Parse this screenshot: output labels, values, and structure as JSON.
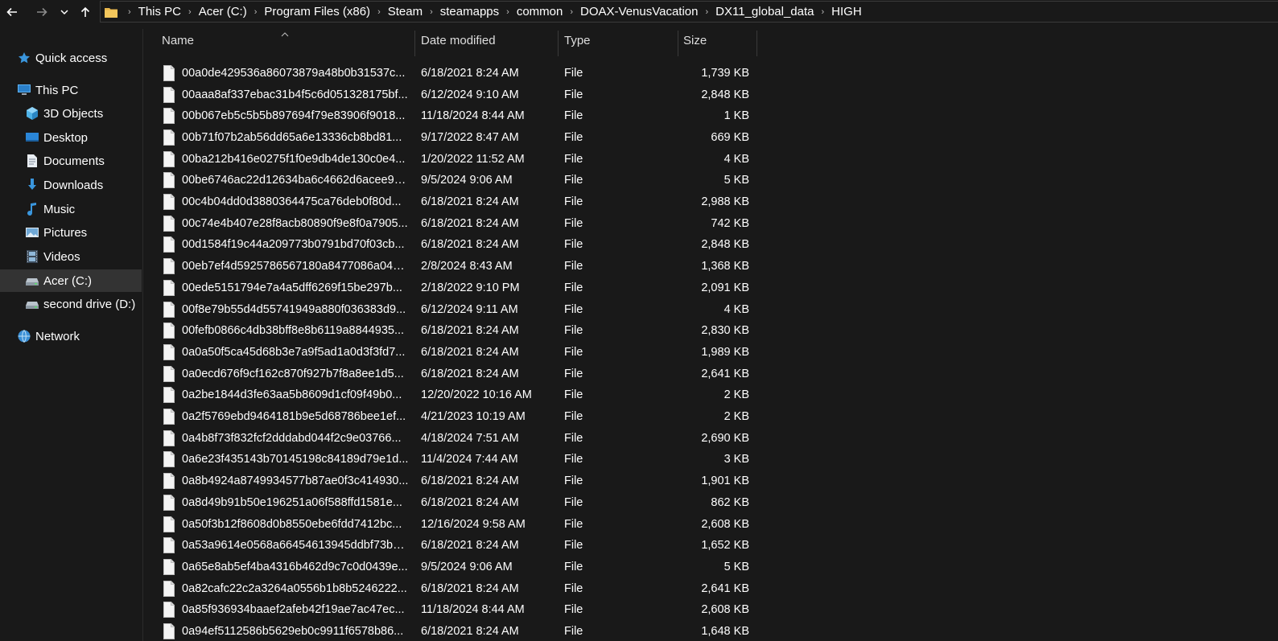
{
  "breadcrumb": [
    "This PC",
    "Acer (C:)",
    "Program Files (x86)",
    "Steam",
    "steamapps",
    "common",
    "DOAX-VenusVacation",
    "DX11_global_data",
    "HIGH"
  ],
  "sidebar": {
    "items": [
      {
        "label": "Quick access",
        "icon": "star-icon",
        "level": 0
      },
      {
        "label": "This PC",
        "icon": "computer-icon",
        "level": 0
      },
      {
        "label": "3D Objects",
        "icon": "cube-icon",
        "level": 1
      },
      {
        "label": "Desktop",
        "icon": "desktop-icon",
        "level": 1
      },
      {
        "label": "Documents",
        "icon": "document-icon",
        "level": 1
      },
      {
        "label": "Downloads",
        "icon": "download-icon",
        "level": 1
      },
      {
        "label": "Music",
        "icon": "music-note-icon",
        "level": 1
      },
      {
        "label": "Pictures",
        "icon": "picture-icon",
        "level": 1
      },
      {
        "label": "Videos",
        "icon": "film-icon",
        "level": 1
      },
      {
        "label": "Acer (C:)",
        "icon": "drive-icon",
        "level": 1
      },
      {
        "label": "second drive (D:)",
        "icon": "drive-icon",
        "level": 1
      },
      {
        "label": "Network",
        "icon": "network-icon",
        "level": 0
      }
    ],
    "selected": "Acer (C:)"
  },
  "columns": {
    "name": "Name",
    "date": "Date modified",
    "type": "Type",
    "size": "Size"
  },
  "files": [
    {
      "name": "00a0de429536a86073879a48b0b31537c...",
      "date": "6/18/2021 8:24 AM",
      "type": "File",
      "size": "1,739 KB"
    },
    {
      "name": "00aaa8af337ebac31b4f5c6d051328175bf...",
      "date": "6/12/2024 9:10 AM",
      "type": "File",
      "size": "2,848 KB"
    },
    {
      "name": "00b067eb5c5b5b897694f79e83906f9018...",
      "date": "11/18/2024 8:44 AM",
      "type": "File",
      "size": "1 KB"
    },
    {
      "name": "00b71f07b2ab56dd65a6e13336cb8bd81...",
      "date": "9/17/2022 8:47 AM",
      "type": "File",
      "size": "669 KB"
    },
    {
      "name": "00ba212b416e0275f1f0e9db4de130c0e4...",
      "date": "1/20/2022 11:52 AM",
      "type": "File",
      "size": "4 KB"
    },
    {
      "name": "00be6746ac22d12634ba6c4662d6acee91...",
      "date": "9/5/2024 9:06 AM",
      "type": "File",
      "size": "5 KB"
    },
    {
      "name": "00c4b04dd0d3880364475ca76deb0f80d...",
      "date": "6/18/2021 8:24 AM",
      "type": "File",
      "size": "2,988 KB"
    },
    {
      "name": "00c74e4b407e28f8acb80890f9e8f0a7905...",
      "date": "6/18/2021 8:24 AM",
      "type": "File",
      "size": "742 KB"
    },
    {
      "name": "00d1584f19c44a209773b0791bd70f03cb...",
      "date": "6/18/2021 8:24 AM",
      "type": "File",
      "size": "2,848 KB"
    },
    {
      "name": "00eb7ef4d5925786567180a8477086a04a...",
      "date": "2/8/2024 8:43 AM",
      "type": "File",
      "size": "1,368 KB"
    },
    {
      "name": "00ede5151794e7a4a5dff6269f15be297b...",
      "date": "2/18/2022 9:10 PM",
      "type": "File",
      "size": "2,091 KB"
    },
    {
      "name": "00f8e79b55d4d55741949a880f036383d9...",
      "date": "6/12/2024 9:11 AM",
      "type": "File",
      "size": "4 KB"
    },
    {
      "name": "00fefb0866c4db38bff8e8b6119a8844935...",
      "date": "6/18/2021 8:24 AM",
      "type": "File",
      "size": "2,830 KB"
    },
    {
      "name": "0a0a50f5ca45d68b3e7a9f5ad1a0d3f3fd7...",
      "date": "6/18/2021 8:24 AM",
      "type": "File",
      "size": "1,989 KB"
    },
    {
      "name": "0a0ecd676f9cf162c870f927b7f8a8ee1d5...",
      "date": "6/18/2021 8:24 AM",
      "type": "File",
      "size": "2,641 KB"
    },
    {
      "name": "0a2be1844d3fe63aa5b8609d1cf09f49b0...",
      "date": "12/20/2022 10:16 AM",
      "type": "File",
      "size": "2 KB"
    },
    {
      "name": "0a2f5769ebd9464181b9e5d68786bee1ef...",
      "date": "4/21/2023 10:19 AM",
      "type": "File",
      "size": "2 KB"
    },
    {
      "name": "0a4b8f73f832fcf2dddabd044f2c9e03766...",
      "date": "4/18/2024 7:51 AM",
      "type": "File",
      "size": "2,690 KB"
    },
    {
      "name": "0a6e23f435143b70145198c84189d79e1d...",
      "date": "11/4/2024 7:44 AM",
      "type": "File",
      "size": "3 KB"
    },
    {
      "name": "0a8b4924a8749934577b87ae0f3c414930...",
      "date": "6/18/2021 8:24 AM",
      "type": "File",
      "size": "1,901 KB"
    },
    {
      "name": "0a8d49b91b50e196251a06f588ffd1581e...",
      "date": "6/18/2021 8:24 AM",
      "type": "File",
      "size": "862 KB"
    },
    {
      "name": "0a50f3b12f8608d0b8550ebe6fdd7412bc...",
      "date": "12/16/2024 9:58 AM",
      "type": "File",
      "size": "2,608 KB"
    },
    {
      "name": "0a53a9614e0568a66454613945ddbf73ba...",
      "date": "6/18/2021 8:24 AM",
      "type": "File",
      "size": "1,652 KB"
    },
    {
      "name": "0a65e8ab5ef4ba4316b462d9c7c0d0439e...",
      "date": "9/5/2024 9:06 AM",
      "type": "File",
      "size": "5 KB"
    },
    {
      "name": "0a82cafc22c2a3264a0556b1b8b5246222...",
      "date": "6/18/2021 8:24 AM",
      "type": "File",
      "size": "2,641 KB"
    },
    {
      "name": "0a85f936934baaef2afeb42f19ae7ac47ec...",
      "date": "11/18/2024 8:44 AM",
      "type": "File",
      "size": "2,608 KB"
    },
    {
      "name": "0a94ef5112586b5629eb0c9911f6578b86...",
      "date": "6/18/2021 8:24 AM",
      "type": "File",
      "size": "1,648 KB"
    }
  ],
  "colors": {
    "background": "#191919",
    "text": "#ffffff",
    "selected": "#333333",
    "accent": "#3a96dd"
  }
}
